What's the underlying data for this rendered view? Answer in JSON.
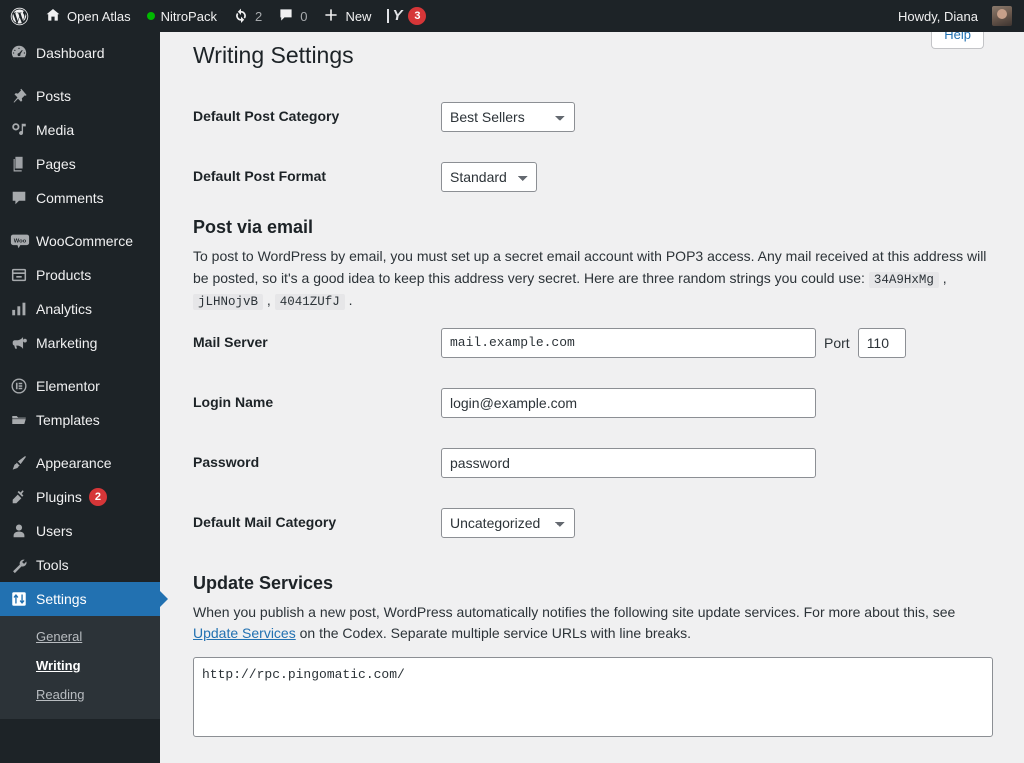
{
  "adminbar": {
    "wp_logo": "wordpress-logo",
    "site_name": "Open Atlas",
    "nitropack": "NitroPack",
    "updates_count": "2",
    "comments_count": "0",
    "new_label": "New",
    "yoast_badge": "3",
    "howdy": "Howdy, Diana"
  },
  "sidebar": {
    "items": [
      {
        "label": "Dashboard",
        "icon": "dashboard-icon",
        "sep": false
      },
      {
        "label": "Posts",
        "icon": "pin-icon",
        "sep": true
      },
      {
        "label": "Media",
        "icon": "media-icon",
        "sep": false
      },
      {
        "label": "Pages",
        "icon": "pages-icon",
        "sep": false
      },
      {
        "label": "Comments",
        "icon": "comment-icon",
        "sep": false
      },
      {
        "label": "WooCommerce",
        "icon": "woocommerce-icon",
        "sep": true
      },
      {
        "label": "Products",
        "icon": "products-icon",
        "sep": false
      },
      {
        "label": "Analytics",
        "icon": "analytics-icon",
        "sep": false
      },
      {
        "label": "Marketing",
        "icon": "megaphone-icon",
        "sep": false
      },
      {
        "label": "Elementor",
        "icon": "elementor-icon",
        "sep": true
      },
      {
        "label": "Templates",
        "icon": "folder-icon",
        "sep": false
      },
      {
        "label": "Appearance",
        "icon": "brush-icon",
        "sep": true
      },
      {
        "label": "Plugins",
        "icon": "plug-icon",
        "sep": false,
        "badge": "2"
      },
      {
        "label": "Users",
        "icon": "user-icon",
        "sep": false
      },
      {
        "label": "Tools",
        "icon": "wrench-icon",
        "sep": false
      },
      {
        "label": "Settings",
        "icon": "settings-icon",
        "sep": false,
        "current": true
      }
    ],
    "submenu": [
      {
        "label": "General",
        "active": false
      },
      {
        "label": "Writing",
        "active": true
      },
      {
        "label": "Reading",
        "active": false
      }
    ]
  },
  "content": {
    "help_tab": "Help",
    "page_title": "Writing Settings",
    "fields": {
      "default_post_category_label": "Default Post Category",
      "default_post_category_value": "Best Sellers",
      "default_post_format_label": "Default Post Format",
      "default_post_format_value": "Standard",
      "mail_server_label": "Mail Server",
      "mail_server_value": "mail.example.com",
      "port_label": "Port",
      "port_value": "110",
      "login_name_label": "Login Name",
      "login_name_value": "login@example.com",
      "password_label": "Password",
      "password_value": "password",
      "default_mail_category_label": "Default Mail Category",
      "default_mail_category_value": "Uncategorized"
    },
    "post_via_email": {
      "heading": "Post via email",
      "text_before": "To post to WordPress by email, you must set up a secret email account with POP3 access. Any mail received at this address will be posted, so it's a good idea to keep this address very secret. Here are three random strings you could use: ",
      "string1": "34A9HxMg",
      "string2": "jLHNojvB",
      "string3": "4041ZUfJ",
      "sep1": " , ",
      "sep2": " , ",
      "end": " ."
    },
    "update_services": {
      "heading": "Update Services",
      "text_before": "When you publish a new post, WordPress automatically notifies the following site update services. For more about this, see ",
      "link_text": "Update Services",
      "text_after": " on the Codex. Separate multiple service URLs with line breaks.",
      "textarea_value": "http://rpc.pingomatic.com/"
    }
  },
  "colors": {
    "admin_bg": "#1d2327",
    "submenu_bg": "#2c3338",
    "accent_blue": "#2271b1",
    "link_blue": "#2271b1",
    "badge_red": "#d63638",
    "content_bg": "#f0f0f1",
    "nitropack_dot": "#00b900"
  }
}
